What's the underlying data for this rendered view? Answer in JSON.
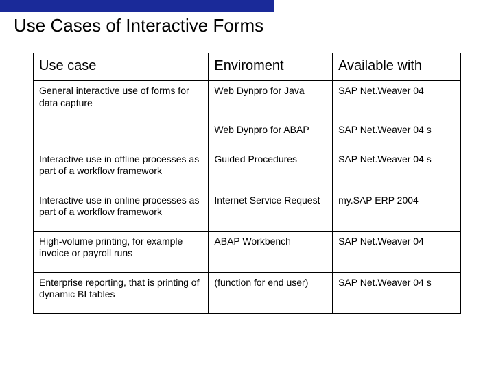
{
  "header": {
    "title": "Use Cases of Interactive Forms"
  },
  "table": {
    "columns": {
      "usecase": "Use case",
      "environment": "Enviroment",
      "available": "Available with"
    },
    "rows": [
      {
        "usecase": "General interactive use of forms for data capture",
        "environment": "Web Dynpro for Java",
        "available": "SAP Net.Weaver 04"
      },
      {
        "usecase": "",
        "environment": "Web Dynpro for ABAP",
        "available": "SAP Net.Weaver 04 s"
      },
      {
        "usecase": "Interactive use in offline processes as part of a workflow framework",
        "environment": "Guided Procedures",
        "available": "SAP Net.Weaver 04 s"
      },
      {
        "usecase": "Interactive use in online processes as part of a workflow framework",
        "environment": "Internet Service Request",
        "available": "my.SAP ERP 2004"
      },
      {
        "usecase": "High-volume printing, for example invoice or payroll runs",
        "environment": "ABAP Workbench",
        "available": "SAP Net.Weaver 04"
      },
      {
        "usecase": "Enterprise reporting, that is printing of dynamic BI tables",
        "environment": "(function for end user)",
        "available": "SAP Net.Weaver 04 s"
      }
    ]
  }
}
